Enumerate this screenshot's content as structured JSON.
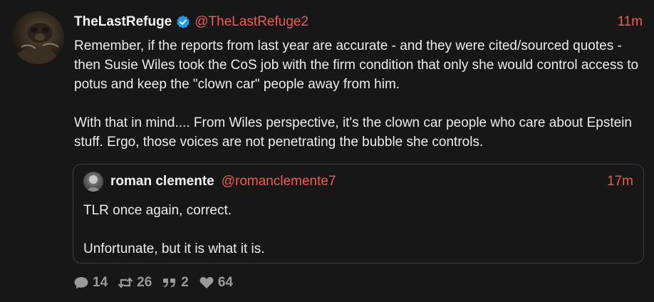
{
  "post": {
    "display_name": "TheLastRefuge",
    "handle": "@TheLastRefuge2",
    "time": "11m",
    "paragraphs": [
      "Remember, if the reports from last year are accurate - and they were cited/sourced quotes - then Susie Wiles took the CoS job with the firm condition that only she would control access to potus and keep the \"clown car\" people away from him.",
      "With that in mind.... From Wiles perspective, it's the clown car people who care about Epstein stuff.  Ergo, those voices are not penetrating the bubble she controls."
    ]
  },
  "quote": {
    "display_name": "roman clemente",
    "handle": "@romanclemente7",
    "time": "17m",
    "paragraphs": [
      "TLR once again, correct.",
      "Unfortunate, but it is what it is."
    ]
  },
  "actions": {
    "replies": "14",
    "reposts": "26",
    "quotes": "2",
    "likes": "64"
  },
  "colors": {
    "background": "#171717",
    "accent": "#ef5b4e",
    "verified": "#1d9bf0",
    "muted": "#9a9a9a"
  },
  "icons": {
    "reply": "speech-bubble-icon",
    "repost": "repost-arrows-icon",
    "quote": "quote-marks-icon",
    "like": "heart-icon",
    "verified": "verified-check-icon"
  }
}
